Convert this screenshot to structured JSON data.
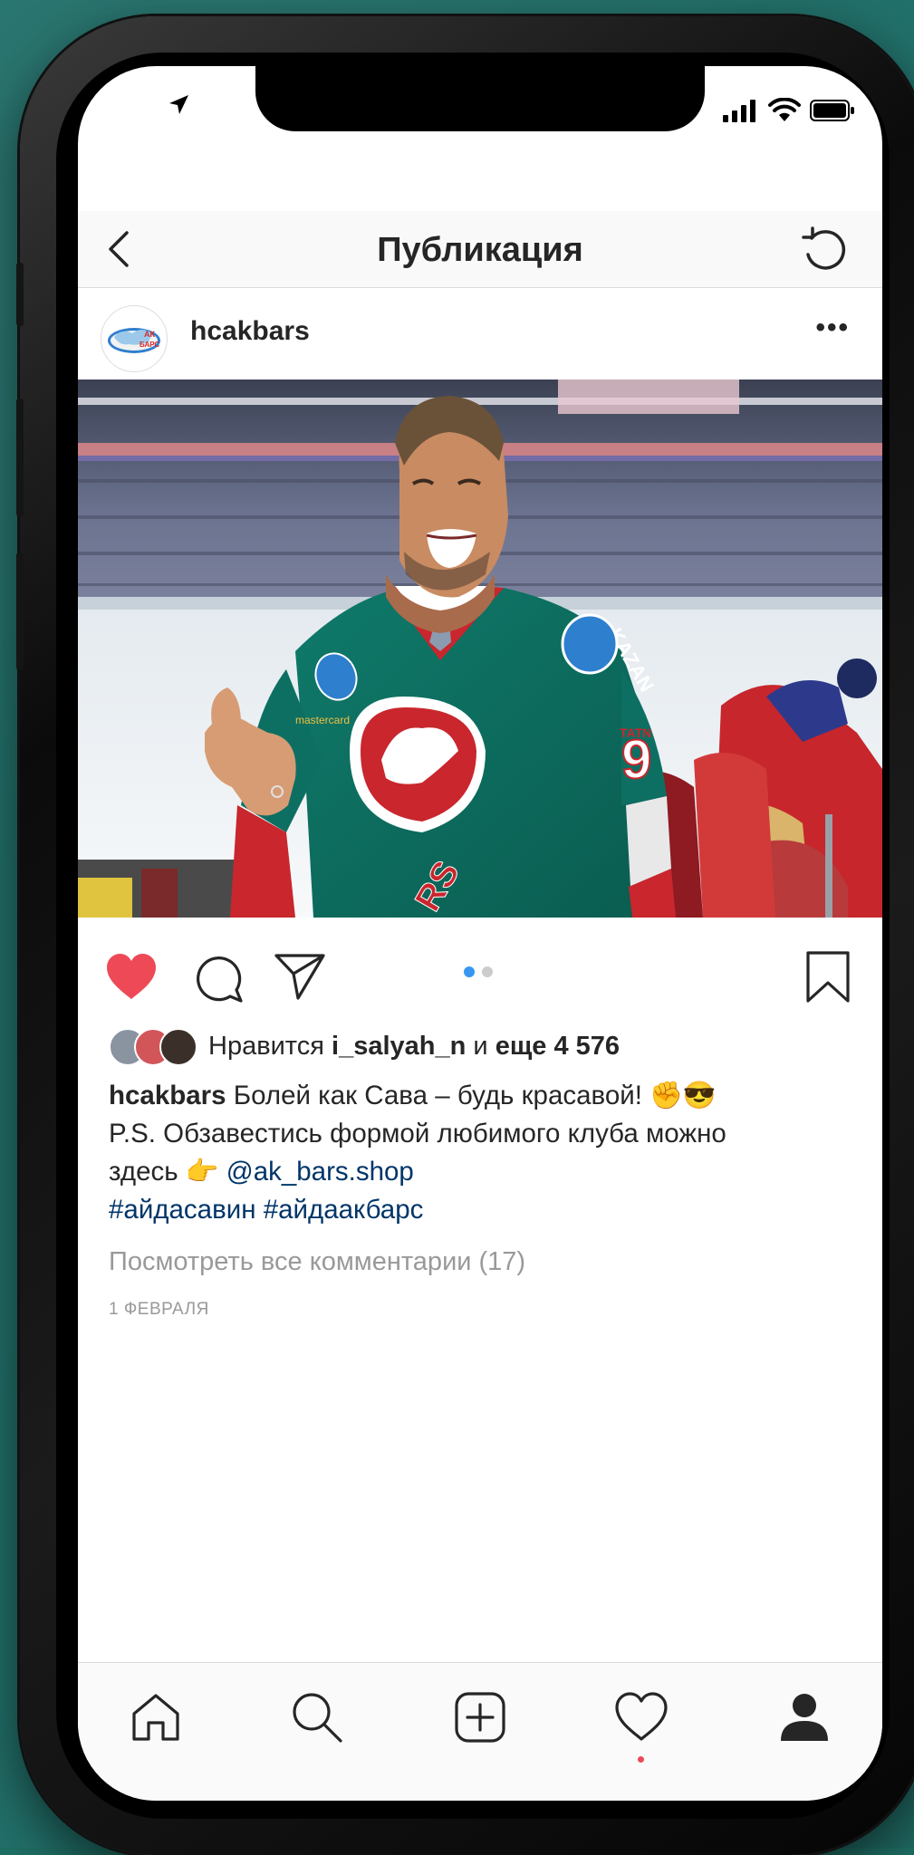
{
  "header": {
    "title": "Публикация"
  },
  "post": {
    "username": "hcakbars",
    "likes": {
      "prefix": "Нравится",
      "user": "i_salyah_n",
      "connector": "и",
      "count_text": "еще 4 576"
    },
    "caption": {
      "username": "hcakbars",
      "line1": "Болей как Сава – будь красавой! ✊😎",
      "line2": "P.S. Обзавестись формой любимого клуба можно",
      "line3_text": "здесь 👉",
      "mention": "@ak_bars.shop",
      "hashtags": "#айдасавин #айдаакбарс"
    },
    "view_comments": "Посмотреть все комментарии (17)",
    "date": "1 ФЕВРАЛЯ",
    "photo_overlay": {
      "jersey_text": "KAZAN",
      "jersey_number": "9",
      "jersey_sponsor": "mastercard",
      "jersey_back_text": "RS",
      "jersey_side": "TATN"
    },
    "avatar_logo_text": "АК БАРС"
  },
  "icons": {
    "back": "chevron-left-icon",
    "refresh": "refresh-icon",
    "more": "ellipsis-icon",
    "like": "heart-icon",
    "comment": "comment-icon",
    "share": "send-icon",
    "save": "bookmark-icon",
    "tabs": [
      "home-icon",
      "search-icon",
      "add-icon",
      "activity-icon",
      "profile-icon"
    ]
  },
  "colors": {
    "like_red": "#ed4956",
    "link_blue": "#003569",
    "dot_active": "#3897f0"
  },
  "carousel": {
    "count": 2,
    "active": 1
  }
}
